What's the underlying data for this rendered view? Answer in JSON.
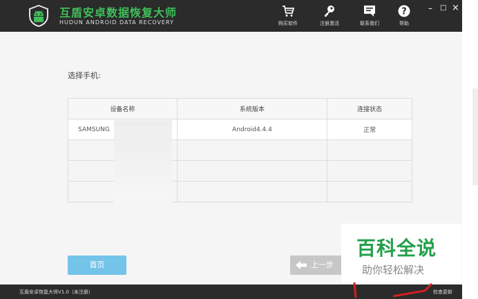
{
  "app": {
    "title_cn": "互盾安卓数据恢复大师",
    "title_en": "HUDUN ANDROID DATA RECOVERY"
  },
  "nav": [
    {
      "label": "购买软件",
      "icon": "cart-icon"
    },
    {
      "label": "注册激活",
      "icon": "key-icon"
    },
    {
      "label": "联系我们",
      "icon": "chat-icon"
    },
    {
      "label": "帮助",
      "icon": "help-icon"
    }
  ],
  "window_controls": {
    "minimize": "–",
    "maximize": "□",
    "close": "×"
  },
  "main": {
    "select_label": "选择手机:",
    "table": {
      "headers": [
        "设备名称",
        "系统版本",
        "连接状态"
      ],
      "rows": [
        [
          "SAMSUNG",
          "Android4.4.4",
          "正常"
        ]
      ]
    },
    "home_button": "首页",
    "prev_button": "上一步"
  },
  "status": {
    "text": "互盾安卓恢复大师V1.0（未注册）",
    "check_update": "检查更新"
  },
  "watermark": {
    "title": "百科全说",
    "subtitle": "助你轻松解决"
  },
  "colors": {
    "titlebar": "#2b2b2b",
    "brand_green": "#3fbf5a",
    "home_button": "#74c3e8",
    "prev_button": "#c7c7c7",
    "watermark_green": "#22a04a"
  }
}
